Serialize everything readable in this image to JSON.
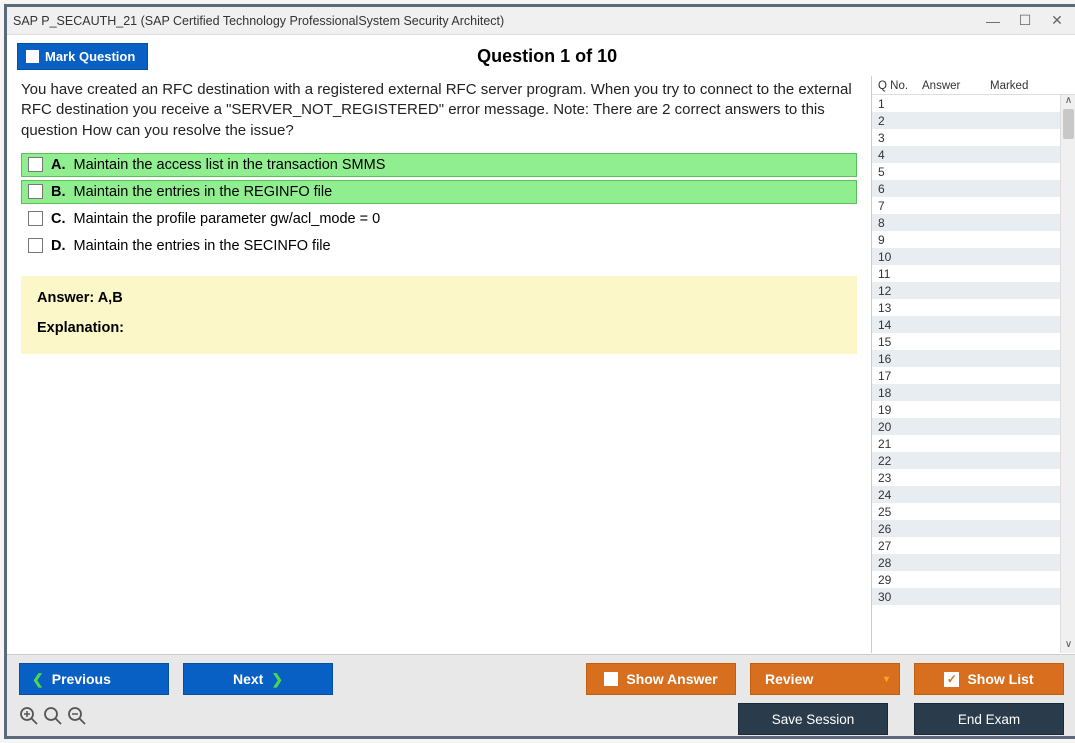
{
  "window": {
    "title": "SAP P_SECAUTH_21 (SAP Certified Technology ProfessionalSystem Security Architect)"
  },
  "topbar": {
    "mark_label": "Mark Question",
    "question_title": "Question 1 of 10"
  },
  "question": {
    "text": "You have created an RFC destination with a registered external RFC server program. When you try to connect to the external RFC destination you receive a \"SERVER_NOT_REGISTERED\" error message. Note: There are 2 correct answers to this question How can you resolve the issue?",
    "choices": [
      {
        "letter": "A.",
        "text": "Maintain the access list in the transaction SMMS",
        "correct": true
      },
      {
        "letter": "B.",
        "text": "Maintain the entries in the REGINFO file",
        "correct": true
      },
      {
        "letter": "C.",
        "text": "Maintain the profile parameter gw/acl_mode = 0",
        "correct": false
      },
      {
        "letter": "D.",
        "text": "Maintain the entries in the SECINFO file",
        "correct": false
      }
    ],
    "answer_label": "Answer: A,B",
    "explanation_label": "Explanation:"
  },
  "sidepanel": {
    "col_qno": "Q No.",
    "col_answer": "Answer",
    "col_marked": "Marked",
    "rows": 30
  },
  "footer": {
    "previous": "Previous",
    "next": "Next",
    "show_answer": "Show Answer",
    "review": "Review",
    "show_list": "Show List",
    "save_session": "Save Session",
    "end_exam": "End Exam"
  }
}
